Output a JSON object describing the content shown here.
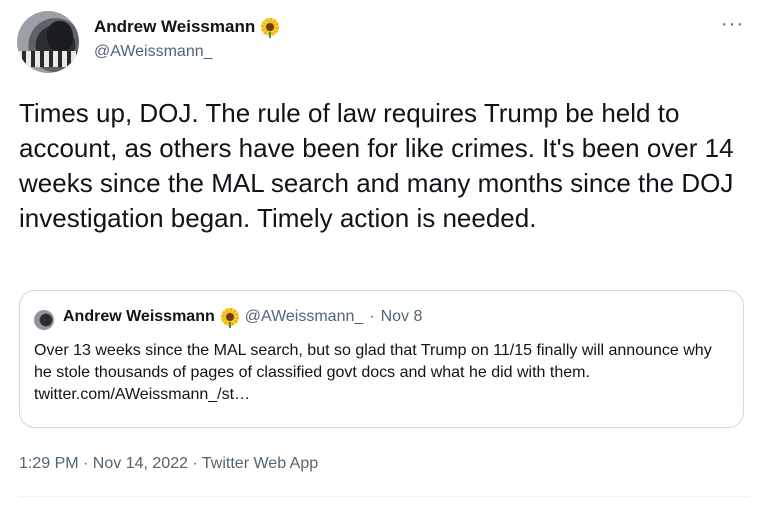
{
  "author": {
    "name": "Andrew Weissmann",
    "handle": "@AWeissmann_",
    "badge_icon": "sunflower-icon"
  },
  "more_label": "···",
  "tweet_text": "Times up, DOJ. The rule of law requires Trump be held to account, as others have been for like crimes. It's been over 14 weeks since the MAL search and many months since the DOJ investigation began. Timely action is needed.",
  "quoted": {
    "name": "Andrew Weissmann",
    "handle": "@AWeissmann_",
    "separator": "·",
    "date": "Nov 8",
    "text": "Over 13 weeks since the MAL search, but so glad that Trump on 11/15 finally will announce why he stole thousands of pages of classified govt docs and what he did with them. twitter.com/AWeissmann_/st…"
  },
  "timestamp": "1:29 PM · Nov 14, 2022 · Twitter Web App",
  "colors": {
    "text": "#0f1419",
    "secondary": "#536471",
    "border": "#cfd9de"
  }
}
